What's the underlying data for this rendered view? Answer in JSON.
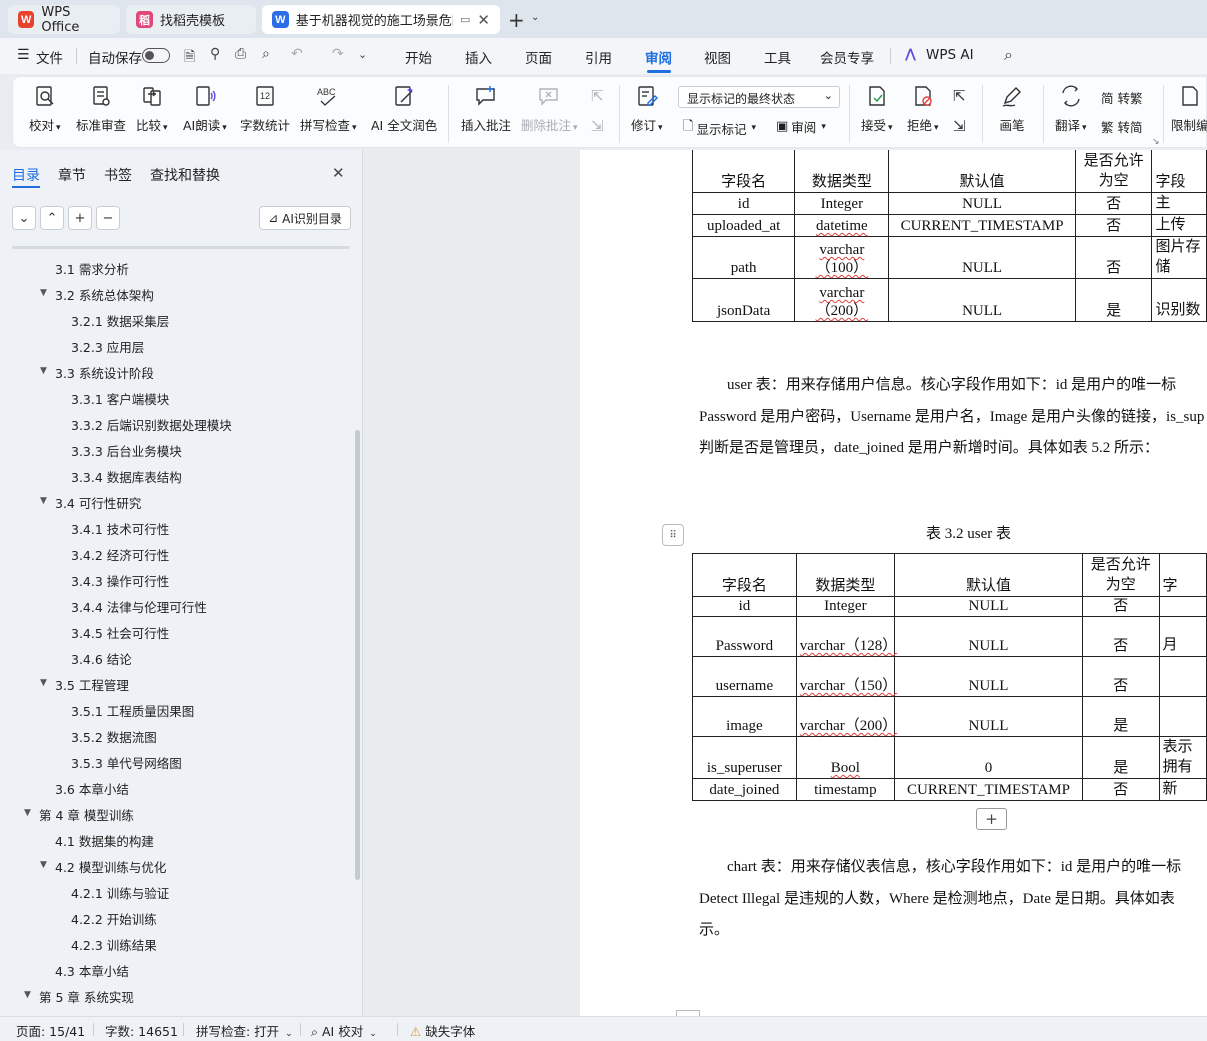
{
  "tabs": [
    {
      "label": "WPS Office"
    },
    {
      "label": "找稻壳模板"
    },
    {
      "label": "基于机器视觉的施工场景危险"
    }
  ],
  "menu": {
    "file": "文件",
    "autosave": "自动保存",
    "items": [
      "开始",
      "插入",
      "页面",
      "引用",
      "审阅",
      "视图",
      "工具",
      "会员专享",
      "WPS AI"
    ]
  },
  "ribbon": {
    "proofread": "校对",
    "std_review": "标准审查",
    "compare": "比较",
    "ai_read": "AI朗读",
    "word_count": "字数统计",
    "spell_check": "拼写检查",
    "ai_polish": "AI 全文润色",
    "insert_comment": "插入批注",
    "delete_comment": "删除批注",
    "revise": "修订",
    "show_state_value": "显示标记的最终状态",
    "show_marks": "显示标记",
    "review": "审阅",
    "accept": "接受",
    "reject": "拒绝",
    "brush": "画笔",
    "translate": "翻译",
    "to_traditional": "简 转繁",
    "to_simplified": "繁 转简",
    "restrict": "限制编"
  },
  "panel": {
    "tabs": [
      "目录",
      "章节",
      "书签",
      "查找和替换"
    ],
    "ai_toc": "AI识别目录",
    "toc": [
      {
        "text": "3.1 需求分析",
        "level": 2,
        "arrow": false
      },
      {
        "text": "3.2 系统总体架构",
        "level": 2,
        "arrow": true
      },
      {
        "text": "3.2.1 数据采集层",
        "level": 3,
        "arrow": false
      },
      {
        "text": "3.2.3 应用层",
        "level": 3,
        "arrow": false
      },
      {
        "text": "3.3 系统设计阶段",
        "level": 2,
        "arrow": true
      },
      {
        "text": "3.3.1 客户端模块",
        "level": 3,
        "arrow": false
      },
      {
        "text": "3.3.2 后端识别数据处理模块",
        "level": 3,
        "arrow": false
      },
      {
        "text": "3.3.3 后台业务模块",
        "level": 3,
        "arrow": false
      },
      {
        "text": "3.3.4 数据库表结构",
        "level": 3,
        "arrow": false
      },
      {
        "text": "3.4 可行性研究",
        "level": 2,
        "arrow": true
      },
      {
        "text": "3.4.1 技术可行性",
        "level": 3,
        "arrow": false
      },
      {
        "text": "3.4.2 经济可行性",
        "level": 3,
        "arrow": false
      },
      {
        "text": "3.4.3 操作可行性",
        "level": 3,
        "arrow": false
      },
      {
        "text": "3.4.4 法律与伦理可行性",
        "level": 3,
        "arrow": false
      },
      {
        "text": "3.4.5 社会可行性",
        "level": 3,
        "arrow": false
      },
      {
        "text": "3.4.6 结论",
        "level": 3,
        "arrow": false
      },
      {
        "text": "3.5 工程管理",
        "level": 2,
        "arrow": true
      },
      {
        "text": "3.5.1 工程质量因果图",
        "level": 3,
        "arrow": false
      },
      {
        "text": "3.5.2 数据流图",
        "level": 3,
        "arrow": false
      },
      {
        "text": "3.5.3 单代号网络图",
        "level": 3,
        "arrow": false
      },
      {
        "text": "3.6 本章小结",
        "level": 2,
        "arrow": false
      },
      {
        "text": "第 4 章  模型训练",
        "level": 1,
        "arrow": true
      },
      {
        "text": "4.1 数据集的构建",
        "level": 2,
        "arrow": false
      },
      {
        "text": "4.2 模型训练与优化",
        "level": 2,
        "arrow": true
      },
      {
        "text": "4.2.1 训练与验证",
        "level": 3,
        "arrow": false
      },
      {
        "text": "4.2.2 开始训练",
        "level": 3,
        "arrow": false
      },
      {
        "text": "4.2.3 训练结果",
        "level": 3,
        "arrow": false
      },
      {
        "text": "4.3 本章小结",
        "level": 2,
        "arrow": false
      },
      {
        "text": "第 5 章  系统实现",
        "level": 1,
        "arrow": true
      }
    ]
  },
  "doc": {
    "table1": {
      "headers": [
        "字段名",
        "数据类型",
        "默认值",
        "是否允许为空",
        "字段"
      ],
      "rows": [
        [
          "id",
          "Integer",
          "NULL",
          "否",
          "主"
        ],
        [
          "uploaded_at",
          "datetime",
          "CURRENT_TIMESTAMP",
          "否",
          "上传"
        ],
        [
          "path",
          "varchar（100）",
          "NULL",
          "否",
          "图片存储"
        ],
        [
          "jsonData",
          "varchar（200）",
          "NULL",
          "是",
          "识别数"
        ]
      ]
    },
    "para1": [
      "user 表：用来存储用户信息。核心字段作用如下：id 是用户的唯一标",
      "Password 是用户密码，Username 是用户名，Image 是用户头像的链接，is_sup",
      "判断是否是管理员，date_joined 是用户新增时间。具体如表 5.2 所示："
    ],
    "table2_caption": "表 3.2  user 表",
    "table2": {
      "headers": [
        "字段名",
        "数据类型",
        "默认值",
        "是否允许为空",
        "字"
      ],
      "rows": [
        [
          "id",
          "Integer",
          "NULL",
          "否",
          ""
        ],
        [
          "Password",
          "varchar（128）",
          "NULL",
          "否",
          "月"
        ],
        [
          "username",
          "varchar（150）",
          "NULL",
          "否",
          ""
        ],
        [
          "image",
          "varchar（200）",
          "NULL",
          "是",
          ""
        ],
        [
          "is_superuser",
          "Bool",
          "0",
          "是",
          "表示拥有"
        ],
        [
          "date_joined",
          "timestamp",
          "CURRENT_TIMESTAMP",
          "否",
          "新"
        ]
      ]
    },
    "para2": [
      "chart 表：用来存储仪表信息，核心字段作用如下：id 是用户的唯一标",
      "Detect Illegal 是违规的人数，Where 是检测地点，Date 是日期。具体如表",
      "示。"
    ]
  },
  "status": {
    "page": "页面: 15/41",
    "words": "字数: 14651",
    "spell": "拼写检查: 打开",
    "ai_proof": "AI 校对",
    "missing_font": "缺失字体"
  },
  "colors": {
    "accent": "#1f6fe0",
    "wps_red": "#e8412c",
    "wps_blue": "#2a6ee8",
    "pink": "#e0487a"
  }
}
